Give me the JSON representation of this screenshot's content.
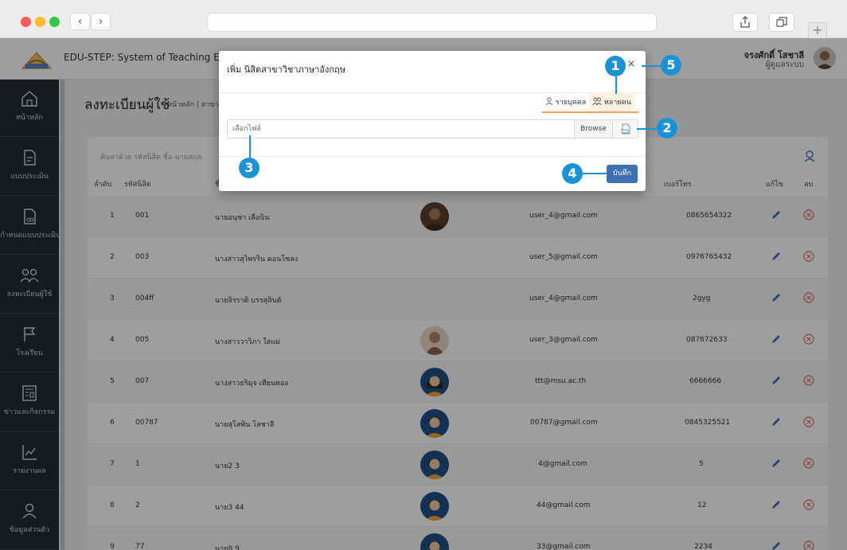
{
  "app": {
    "brand": "EDU-STEP: System of Teaching Experience",
    "user_name": "จรงศักดิ์ โสชาลี",
    "user_role": "ผู้ดูแลระบบ"
  },
  "sidebar": {
    "items": [
      {
        "label": "หน้าหลัก",
        "icon": "home-icon"
      },
      {
        "label": "แบบประเมิน",
        "icon": "document-icon"
      },
      {
        "label": "กำหนดแบบประเมิน",
        "icon": "document-link-icon"
      },
      {
        "label": "ลงทะเบียนผู้ใช้",
        "icon": "users-icon"
      },
      {
        "label": "โรงเรียน",
        "icon": "flag-icon"
      },
      {
        "label": "ข่าวและกิจกรรม",
        "icon": "news-icon"
      },
      {
        "label": "รายงานผล",
        "icon": "chart-icon"
      },
      {
        "label": "ข้อมูลส่วนตัว",
        "icon": "person-icon"
      }
    ]
  },
  "page": {
    "title": "ลงทะเบียนผู้ใช้",
    "breadcrumb": "หน้าหลัก | สาขาวิ"
  },
  "table": {
    "search_placeholder": "ค้นหาด้วย รหัสนิสิต ชื่อ-นามสกุล",
    "headers": {
      "index": "ลำดับ",
      "code": "รหัสนิสิต",
      "name": "ชื่",
      "phone": "เบอร์โทร",
      "edit": "แก้ไข",
      "delete": "ลบ"
    },
    "rows": [
      {
        "index": "1",
        "code": "001",
        "name": "นายอนุชา เลือนิน",
        "email": "user_4@gmail.com",
        "phone": "0865654322",
        "avatar": "photo-brown"
      },
      {
        "index": "2",
        "code": "003",
        "name": "นางสาวสุไพรริน ดอนโซลง",
        "email": "user_5@gmail.com",
        "phone": "0976765432",
        "avatar": ""
      },
      {
        "index": "3",
        "code": "004ff",
        "name": "นายจิรราติ บรรสุสินต์",
        "email": "user_4@gmail.com",
        "phone": "2gyg",
        "avatar": ""
      },
      {
        "index": "4",
        "code": "005",
        "name": "นางสาววาวิภา ใสแม่",
        "email": "user_3@gmail.com",
        "phone": "087672633",
        "avatar": "photo-tan"
      },
      {
        "index": "5",
        "code": "007",
        "name": "นางสาวธริมุจ เทียนทอง",
        "email": "ttt@msu.ac.th",
        "phone": "6666666",
        "avatar": "female"
      },
      {
        "index": "6",
        "code": "00787",
        "name": "นายสุโสพิน โสชาลี",
        "email": "00787@gmail.com",
        "phone": "0845325521",
        "avatar": "male"
      },
      {
        "index": "7",
        "code": "1",
        "name": "นาย2 3",
        "email": "4@gmail.com",
        "phone": "5",
        "avatar": "male"
      },
      {
        "index": "8",
        "code": "2",
        "name": "นาย3 44",
        "email": "44@gmail.com",
        "phone": "12",
        "avatar": "male"
      },
      {
        "index": "9",
        "code": "77",
        "name": "นาย8 9",
        "email": "33@gmail.com",
        "phone": "2234",
        "avatar": "male"
      }
    ]
  },
  "modal": {
    "title": "เพิ่ม นิสิตสาขาวิชาภาษาอังกฤษ",
    "close": "×",
    "tab_single": "รายบุคคล",
    "tab_multi": "หลายคน",
    "file_placeholder": "เลือกไฟล์",
    "browse": "Browse",
    "save": "บันทึก"
  },
  "callouts": [
    "1",
    "2",
    "3",
    "4",
    "5"
  ],
  "colors": {
    "sidebar_bg": "#262b33",
    "accent_blue": "#3f6fb4",
    "callout_blue": "#1a93d6",
    "tab_accent": "#f3a55a",
    "delete_red": "#e06a5a"
  }
}
